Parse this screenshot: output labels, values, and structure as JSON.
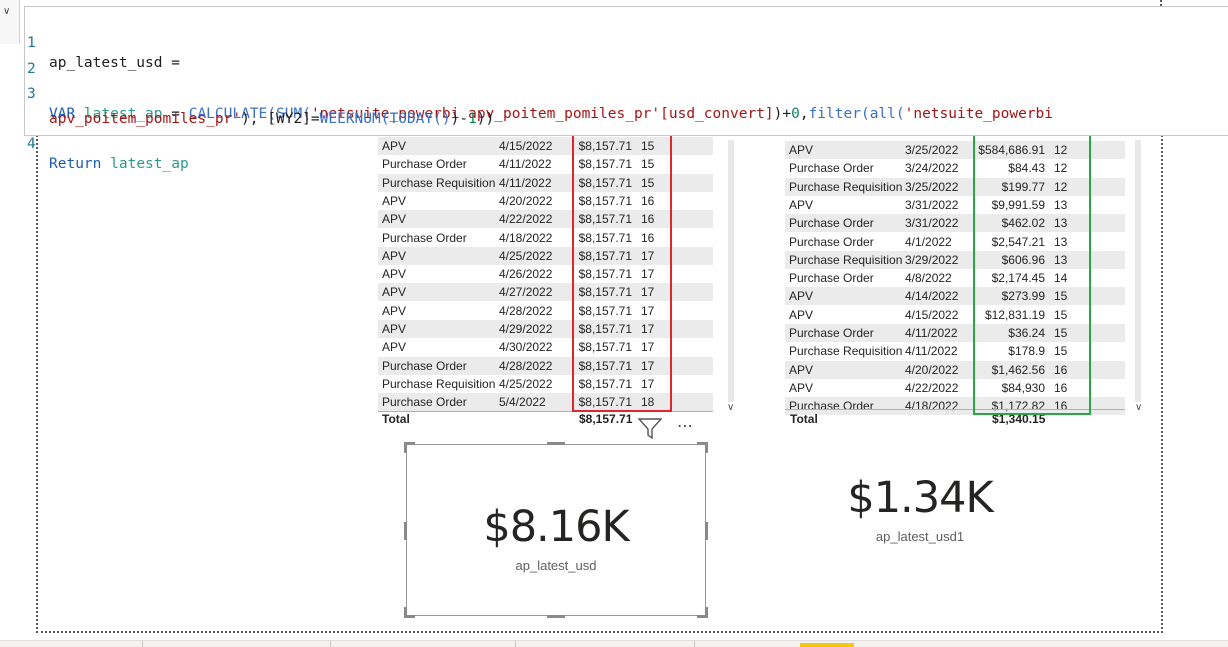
{
  "formula": {
    "measure_name": "ap_latest_usd =",
    "line_numbers": [
      "1",
      "2",
      "3",
      "4"
    ],
    "line3_var_kw": "VAR",
    "line3_var_name": "latest_ap",
    "line3_eq": " = ",
    "line3_calc": "CALCULATE(",
    "line3_sum": "SUM(",
    "line3_table_col": "'netsuite_powerbi apv_poitem_pomiles_pr'[usd_convert]",
    "line3_close_plus": ")+",
    "line3_zero": "0",
    "line3_comma": ",",
    "line3_filter": "filter(",
    "line3_all": "all(",
    "line3_table2": "'netsuite_powerbi",
    "line3b_table2": "apv_poitem_pomiles_pr'",
    "line3b_mid": "), [WY2]=",
    "line3b_weeknum": "WEEKNUM(",
    "line3b_today": "TODAY()",
    "line3b_minus": ")-",
    "line3b_one": "1",
    "line3b_end": "))",
    "line4_return": "Return",
    "line4_var": "latest_ap"
  },
  "left_table": {
    "rows": [
      {
        "type": "APV",
        "date": "4/15/2022",
        "amount": "$8,157.71",
        "week": "15"
      },
      {
        "type": "Purchase Order",
        "date": "4/11/2022",
        "amount": "$8,157.71",
        "week": "15"
      },
      {
        "type": "Purchase Requisition",
        "date": "4/11/2022",
        "amount": "$8,157.71",
        "week": "15"
      },
      {
        "type": "APV",
        "date": "4/20/2022",
        "amount": "$8,157.71",
        "week": "16"
      },
      {
        "type": "APV",
        "date": "4/22/2022",
        "amount": "$8,157.71",
        "week": "16"
      },
      {
        "type": "Purchase Order",
        "date": "4/18/2022",
        "amount": "$8,157.71",
        "week": "16"
      },
      {
        "type": "APV",
        "date": "4/25/2022",
        "amount": "$8,157.71",
        "week": "17"
      },
      {
        "type": "APV",
        "date": "4/26/2022",
        "amount": "$8,157.71",
        "week": "17"
      },
      {
        "type": "APV",
        "date": "4/27/2022",
        "amount": "$8,157.71",
        "week": "17"
      },
      {
        "type": "APV",
        "date": "4/28/2022",
        "amount": "$8,157.71",
        "week": "17"
      },
      {
        "type": "APV",
        "date": "4/29/2022",
        "amount": "$8,157.71",
        "week": "17"
      },
      {
        "type": "APV",
        "date": "4/30/2022",
        "amount": "$8,157.71",
        "week": "17"
      },
      {
        "type": "Purchase Order",
        "date": "4/28/2022",
        "amount": "$8,157.71",
        "week": "17"
      },
      {
        "type": "Purchase Requisition",
        "date": "4/25/2022",
        "amount": "$8,157.71",
        "week": "17"
      },
      {
        "type": "Purchase Order",
        "date": "5/4/2022",
        "amount": "$8,157.71",
        "week": "18"
      }
    ],
    "total_label": "Total",
    "total_amount": "$8,157.71"
  },
  "right_table": {
    "rows": [
      {
        "type": "APV",
        "date": "3/25/2022",
        "amount": "$584,686.91",
        "week": "12"
      },
      {
        "type": "Purchase Order",
        "date": "3/24/2022",
        "amount": "$84.43",
        "week": "12"
      },
      {
        "type": "Purchase Requisition",
        "date": "3/25/2022",
        "amount": "$199.77",
        "week": "12"
      },
      {
        "type": "APV",
        "date": "3/31/2022",
        "amount": "$9,991.59",
        "week": "13"
      },
      {
        "type": "Purchase Order",
        "date": "3/31/2022",
        "amount": "$462.02",
        "week": "13"
      },
      {
        "type": "Purchase Order",
        "date": "4/1/2022",
        "amount": "$2,547.21",
        "week": "13"
      },
      {
        "type": "Purchase Requisition",
        "date": "3/29/2022",
        "amount": "$606.96",
        "week": "13"
      },
      {
        "type": "Purchase Order",
        "date": "4/8/2022",
        "amount": "$2,174.45",
        "week": "14"
      },
      {
        "type": "APV",
        "date": "4/14/2022",
        "amount": "$273.99",
        "week": "15"
      },
      {
        "type": "APV",
        "date": "4/15/2022",
        "amount": "$12,831.19",
        "week": "15"
      },
      {
        "type": "Purchase Order",
        "date": "4/11/2022",
        "amount": "$36.24",
        "week": "15"
      },
      {
        "type": "Purchase Requisition",
        "date": "4/11/2022",
        "amount": "$178.9",
        "week": "15"
      },
      {
        "type": "APV",
        "date": "4/20/2022",
        "amount": "$1,462.56",
        "week": "16"
      },
      {
        "type": "APV",
        "date": "4/22/2022",
        "amount": "$84,930",
        "week": "16"
      },
      {
        "type": "Purchase Order",
        "date": "4/18/2022",
        "amount": "$1,172.82",
        "week": "16"
      }
    ],
    "total_label": "Total",
    "total_amount": "$1,340.15"
  },
  "cards": {
    "left_value": "$8.16K",
    "left_label": "ap_latest_usd",
    "right_value": "$1.34K",
    "right_label": "ap_latest_usd1"
  },
  "icons": {
    "filter": "filter-icon",
    "more": "more-options-icon",
    "scroll_down": "chevron-down-icon"
  },
  "colors": {
    "highlight_left": "#e0262c",
    "highlight_right": "#2aa646",
    "active_tab": "#f2c811"
  }
}
